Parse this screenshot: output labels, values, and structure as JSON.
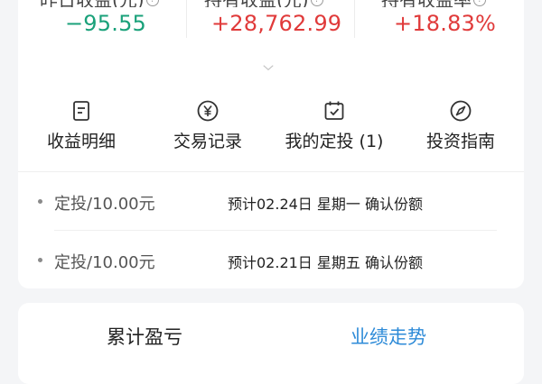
{
  "stats": [
    {
      "label": "昨日收益(元)",
      "value": "−95.55",
      "tone": "negative"
    },
    {
      "label": "持有收益(元)",
      "value": "+28,762.99",
      "tone": "positive"
    },
    {
      "label": "持有收益率",
      "value": "+18.83%",
      "tone": "positive"
    }
  ],
  "actions": [
    {
      "label": "收益明细",
      "icon": "document-icon"
    },
    {
      "label": "交易记录",
      "icon": "yen-circle-icon"
    },
    {
      "label": "我的定投 (1)",
      "icon": "calendar-check-icon"
    },
    {
      "label": "投资指南",
      "icon": "compass-icon"
    }
  ],
  "plans": [
    {
      "amount": "定投/10.00元",
      "note": "预计02.24日 星期一 确认份额"
    },
    {
      "amount": "定投/10.00元",
      "note": "预计02.21日 星期五 确认份额"
    }
  ],
  "tabs": {
    "cumulative": "累计盈亏",
    "performance": "业绩走势"
  },
  "colors": {
    "negative": "#1aa17a",
    "positive": "#e03a3a",
    "accent": "#2e8bd8",
    "background": "#f4f5f7"
  }
}
